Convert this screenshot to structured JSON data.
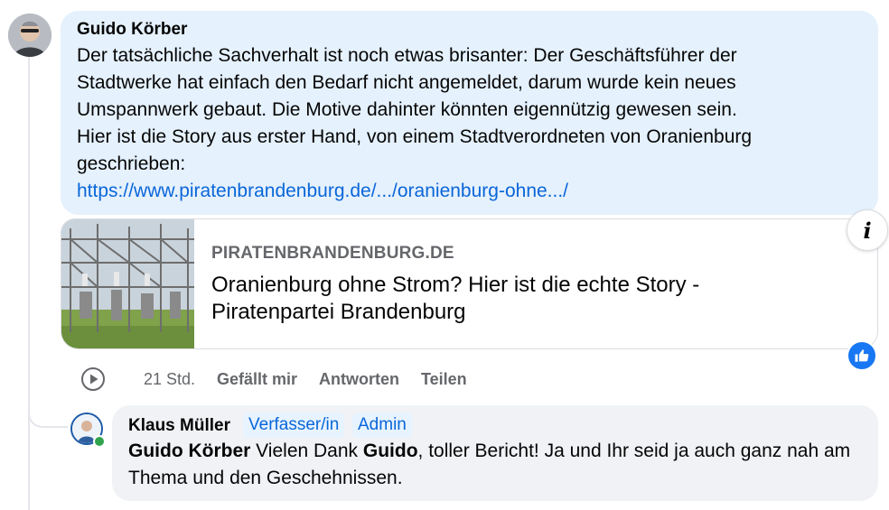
{
  "comment": {
    "author": "Guido Körber",
    "lines": [
      "Der tatsächliche Sachverhalt ist noch etwas brisanter: Der Geschäftsführer der",
      "Stadtwerke hat einfach den Bedarf nicht angemeldet, darum wurde kein neues",
      "Umspannwerk gebaut. Die Motive dahinter könnten eigennützig gewesen sein.",
      "Hier ist die Story aus erster Hand, von einem Stadtverordneten von Oranienburg",
      "geschrieben:"
    ],
    "link_text": "https://www.piratenbrandenburg.de/.../oranienburg-ohne.../",
    "link_preview": {
      "domain": "PIRATENBRANDENBURG.DE",
      "title": "Oranienburg ohne Strom? Hier ist die echte Story - Piratenpartei Brandenburg"
    },
    "info_icon": "info-icon",
    "reaction_icon": "like-icon",
    "accent_color": "#1877f2",
    "actions": {
      "time": "21 Std.",
      "like": "Gefällt mir",
      "reply": "Antworten",
      "share": "Teilen"
    }
  },
  "reply": {
    "author": "Klaus Müller",
    "badges": [
      "Verfasser/in",
      "Admin"
    ],
    "mention": "Guido Körber",
    "text_1": " Vielen Dank ",
    "bold_name": "Guido",
    "text_2": ", toller Bericht! Ja und Ihr seid ja auch ganz nah am Thema und den Geschehnissen."
  }
}
